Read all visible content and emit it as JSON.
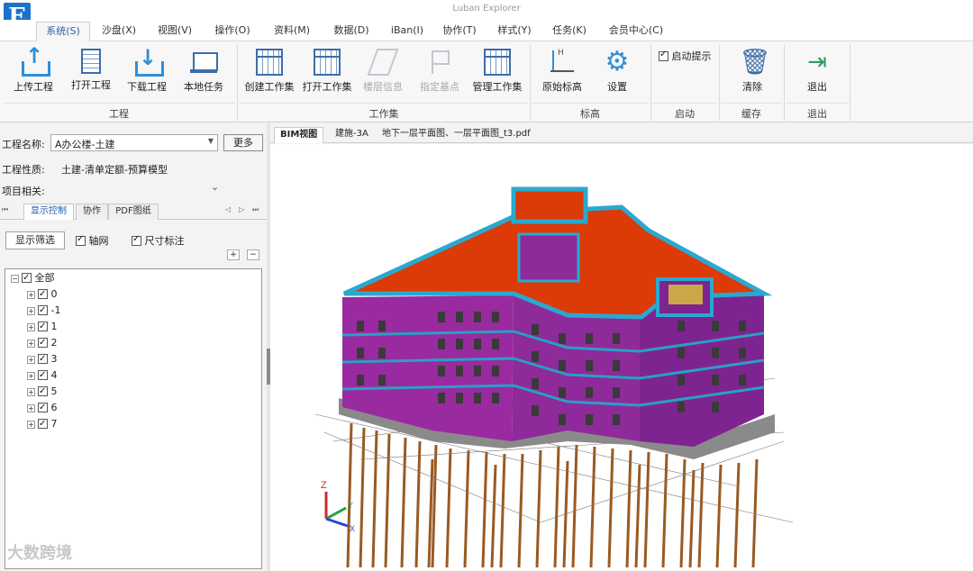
{
  "window": {
    "title": "Luban Explorer",
    "logo_letter": "E"
  },
  "menu": [
    "系统(S)",
    "沙盘(X)",
    "视图(V)",
    "操作(O)",
    "资料(M)",
    "数据(D)",
    "iBan(I)",
    "协作(T)",
    "样式(Y)",
    "任务(K)",
    "会员中心(C)"
  ],
  "ribbon": {
    "project": {
      "label": "工程",
      "buttons": [
        "上传工程",
        "打开工程",
        "下载工程",
        "本地任务"
      ]
    },
    "workset": {
      "label": "工作集",
      "buttons": [
        "创建工作集",
        "打开工作集",
        "楼层信息",
        "指定基点",
        "管理工作集"
      ]
    },
    "elevation": {
      "label": "标高",
      "buttons": [
        "原始标高",
        "设置"
      ]
    },
    "startup": {
      "label": "启动",
      "checkbox": "启动提示"
    },
    "cache": {
      "label": "缓存",
      "button": "清除"
    },
    "exit": {
      "label": "退出",
      "button": "退出"
    }
  },
  "project_panel": {
    "name_label": "工程名称:",
    "name_value": "A办公楼-土建",
    "more_button": "更多",
    "nature_label": "工程性质:",
    "nature_value": "土建-清单定额-预算模型",
    "related_label": "项目相关:",
    "subtabs": [
      "显示控制",
      "协作",
      "PDF图纸"
    ],
    "filter_button": "显示筛选",
    "options": [
      "轴网",
      "尺寸标注"
    ],
    "tree": {
      "root": "全部",
      "children": [
        "0",
        "-1",
        "1",
        "2",
        "3",
        "4",
        "5",
        "6",
        "7"
      ]
    }
  },
  "doc_tabs": [
    "BIM视图",
    "建施-3A",
    "地下一层平面图、一层平面图_t3.pdf"
  ],
  "axes": {
    "z": "Z",
    "y": "Y",
    "x": "X"
  },
  "watermark": "大数跨境"
}
